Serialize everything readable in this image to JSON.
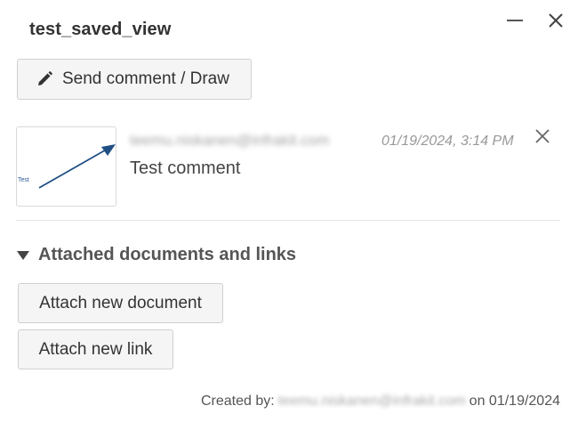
{
  "panel": {
    "title": "test_saved_view"
  },
  "window_controls": {
    "minimize_icon": "minimize-icon",
    "close_icon": "close-icon"
  },
  "toolbar": {
    "send_comment_label": "Send comment / Draw",
    "send_comment_icon": "pencil-icon"
  },
  "comment": {
    "thumbnail_label": "Test",
    "author": "teemu.niskanen@infrakit.com",
    "timestamp": "01/19/2024, 3:14 PM",
    "text": "Test comment",
    "delete_icon": "close-icon"
  },
  "attachments": {
    "section_title": "Attached documents and links",
    "expanded": true,
    "attach_document_label": "Attach new document",
    "attach_link_label": "Attach new link"
  },
  "footer": {
    "created_by_prefix": "Created by:",
    "created_by_user": "teemu.niskanen@infrakit.com",
    "created_on_prefix": "on",
    "created_date": "01/19/2024"
  },
  "colors": {
    "arrow": "#1f4f85",
    "button_bg": "#f5f5f5",
    "button_border": "#d0d0d0"
  }
}
